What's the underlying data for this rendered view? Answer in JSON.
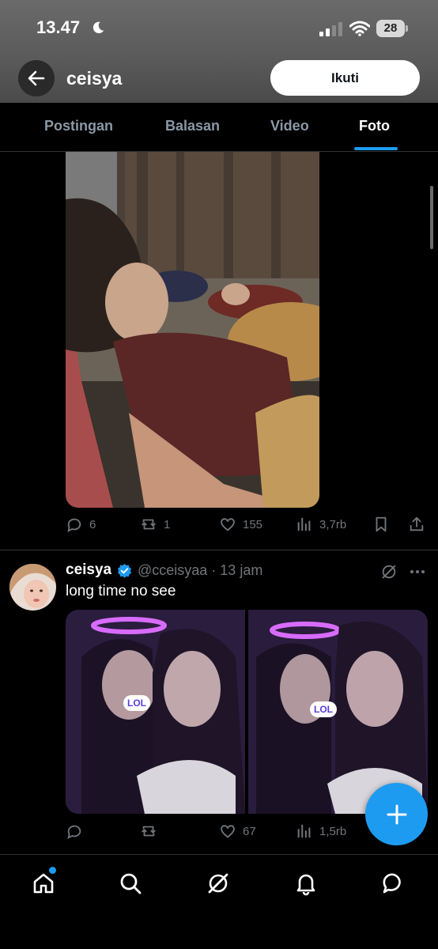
{
  "status_bar": {
    "time": "13.47",
    "battery": "28"
  },
  "header": {
    "name": "ceisya",
    "follow_label": "Ikuti"
  },
  "tabs": [
    {
      "label": "Postingan",
      "active": false
    },
    {
      "label": "Balasan",
      "active": false
    },
    {
      "label": "Video",
      "active": false
    },
    {
      "label": "Foto",
      "active": true
    }
  ],
  "posts": [
    {
      "replies": "6",
      "reposts": "1",
      "likes": "155",
      "views": "3,7rb"
    },
    {
      "display_name": "ceisya",
      "handle_time": "@cceisyaa · 13 jam",
      "text": "long time no see",
      "sticker": "LOL",
      "replies": "",
      "reposts": "",
      "likes": "67",
      "views": "1,5rb"
    }
  ],
  "colors": {
    "accent": "#1d9bf0",
    "muted": "#71767b",
    "background": "#000000"
  },
  "bottom_nav": [
    {
      "icon": "home-icon",
      "has_badge": true
    },
    {
      "icon": "search-icon"
    },
    {
      "icon": "grok-icon"
    },
    {
      "icon": "bell-icon"
    },
    {
      "icon": "messages-icon"
    }
  ]
}
